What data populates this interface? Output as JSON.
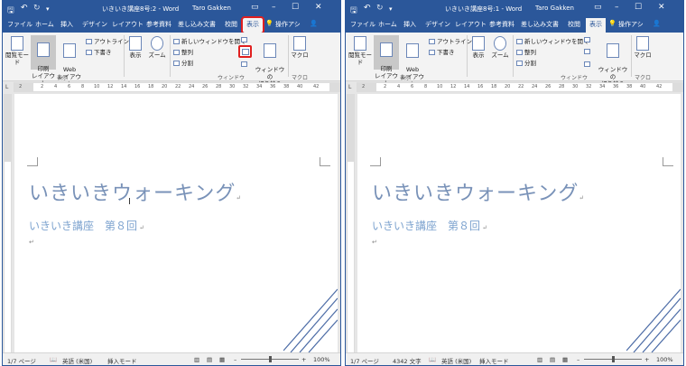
{
  "windows": [
    {
      "title": "いきいき講座8号:2 - Word",
      "user": "Taro Gakken",
      "tabs": [
        "ファイル",
        "ホーム",
        "挿入",
        "デザイン",
        "レイアウト",
        "参考資料",
        "差し込み文書",
        "校閲",
        "表示"
      ],
      "tell_me": "操作アシ",
      "ribbon": {
        "read_mode": "閲覧モード",
        "print_layout": "印刷\nレイアウト",
        "web_layout": "Web\nレイアウト",
        "outline": "アウトライン",
        "draft": "下書き",
        "show": "表示",
        "zoom": "ズーム",
        "new_window": "新しいウィンドウを開く",
        "arrange_all": "整列",
        "split": "分割",
        "switch_windows": "ウィンドウの\n切り替え",
        "macros": "マクロ",
        "group_view": "表示",
        "group_window": "ウィンドウ",
        "group_macros": "マクロ"
      },
      "ruler_numbers": [
        "2",
        "2",
        "4",
        "6",
        "8",
        "10",
        "12",
        "14",
        "16",
        "18",
        "20",
        "22",
        "24",
        "26",
        "28",
        "30",
        "32",
        "34",
        "36",
        "38",
        "40",
        "42"
      ],
      "doc_title": "いきいきウォーキング",
      "doc_subtitle": "いきいき講座　第８回",
      "status": {
        "page": "1/7 ページ",
        "words": "",
        "language": "英語 (米国)",
        "mode": "挿入モード",
        "zoom": "100%"
      }
    },
    {
      "title": "いきいき講座8号:1 - Word",
      "user": "Taro Gakken",
      "tabs": [
        "ファイル",
        "ホーム",
        "挿入",
        "デザイン",
        "レイアウト",
        "参考資料",
        "差し込み文書",
        "校閲",
        "表示"
      ],
      "tell_me": "操作アシ",
      "ribbon": {
        "read_mode": "閲覧モード",
        "print_layout": "印刷\nレイアウト",
        "web_layout": "Web\nレイアウト",
        "outline": "アウトライン",
        "draft": "下書き",
        "show": "表示",
        "zoom": "ズーム",
        "new_window": "新しいウィンドウを開く",
        "arrange_all": "整列",
        "split": "分割",
        "switch_windows": "ウィンドウの\n切り替え",
        "macros": "マクロ",
        "group_view": "表示",
        "group_window": "ウィンドウ",
        "group_macros": "マクロ"
      },
      "ruler_numbers": [
        "2",
        "2",
        "4",
        "6",
        "8",
        "10",
        "12",
        "14",
        "16",
        "18",
        "20",
        "22",
        "24",
        "26",
        "28",
        "30",
        "32",
        "34",
        "36",
        "38",
        "40",
        "42"
      ],
      "doc_title": "いきいきウォーキング",
      "doc_subtitle": "いきいき講座　第８回",
      "status": {
        "page": "1/7 ページ",
        "words": "4342 文字",
        "language": "英語 (米国)",
        "mode": "挿入モード",
        "zoom": "100%"
      }
    }
  ],
  "colors": {
    "word_blue": "#2b579a",
    "highlight_red": "#e01f1f",
    "title_text": "#7992b8",
    "subtitle_text": "#7da3cf"
  },
  "icons": {
    "save": "save-icon",
    "undo": "undo-icon",
    "redo": "redo-icon",
    "customize": "customize-quick-access-icon",
    "ribbon_options": "ribbon-display-options-icon",
    "minimize": "minimize-icon",
    "maximize": "maximize-icon",
    "close": "close-icon",
    "lightbulb": "lightbulb-icon",
    "share": "share-person-icon"
  }
}
